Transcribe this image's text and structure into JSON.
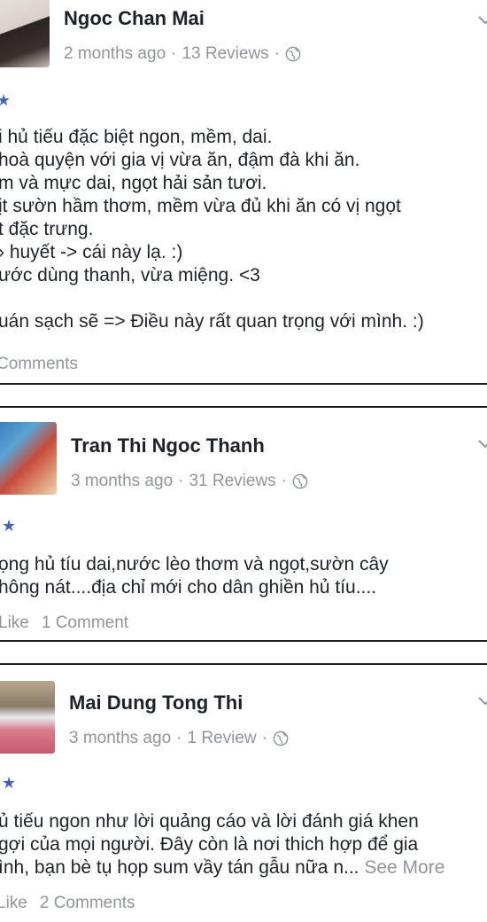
{
  "reviews": [
    {
      "name": "Ngoc Chan Mai",
      "time": "2 months ago",
      "review_count": "13 Reviews",
      "star": "★",
      "lines": [
        "i hủ tiếu đặc biệt ngon, mềm, dai.",
        "hoà quyện với gia vị vừa ăn, đậm đà khi ăn.",
        "m và mực dai, ngọt hải sản tươi.",
        "ịt sườn hầm thơm, mềm vừa đủ khi ăn có vị ngọt",
        "t đặc trưng.",
        "› huyết -> cái này lạ. :)",
        "ước dùng thanh, vừa miệng. <3",
        "",
        "uán sạch sẽ => Điều này rất quan trọng với mình. :)"
      ],
      "comments": "Comments"
    },
    {
      "name": "Tran Thi Ngoc Thanh",
      "time": "3 months ago",
      "review_count": "31 Reviews",
      "star": "★",
      "lines": [
        "ọng hủ tíu dai,nước lèo thơm và ngọt,sườn cây",
        "hông nát....địa chỉ mới cho dân ghiền hủ tíu...."
      ],
      "like": "Like",
      "comments": "1 Comment"
    },
    {
      "name": "Mai Dung Tong Thi",
      "time": "3 months ago",
      "review_count": "1 Review",
      "star": "★",
      "lines": [
        "ủ tiếu ngon như lời quảng cáo và lời đánh giá khen",
        "gợi của mọi người. Đây còn là nơi thich hợp để gia",
        "ình, bạn bè tụ họp sum vầy tán gẫu nữa n..."
      ],
      "see_more": "See More",
      "like": "Like",
      "comments": "2 Comments"
    }
  ],
  "separator": "·",
  "colors": {
    "text": "#1d2129",
    "meta": "#90949c",
    "star": "#4267b2",
    "border": "#1c1e21"
  }
}
